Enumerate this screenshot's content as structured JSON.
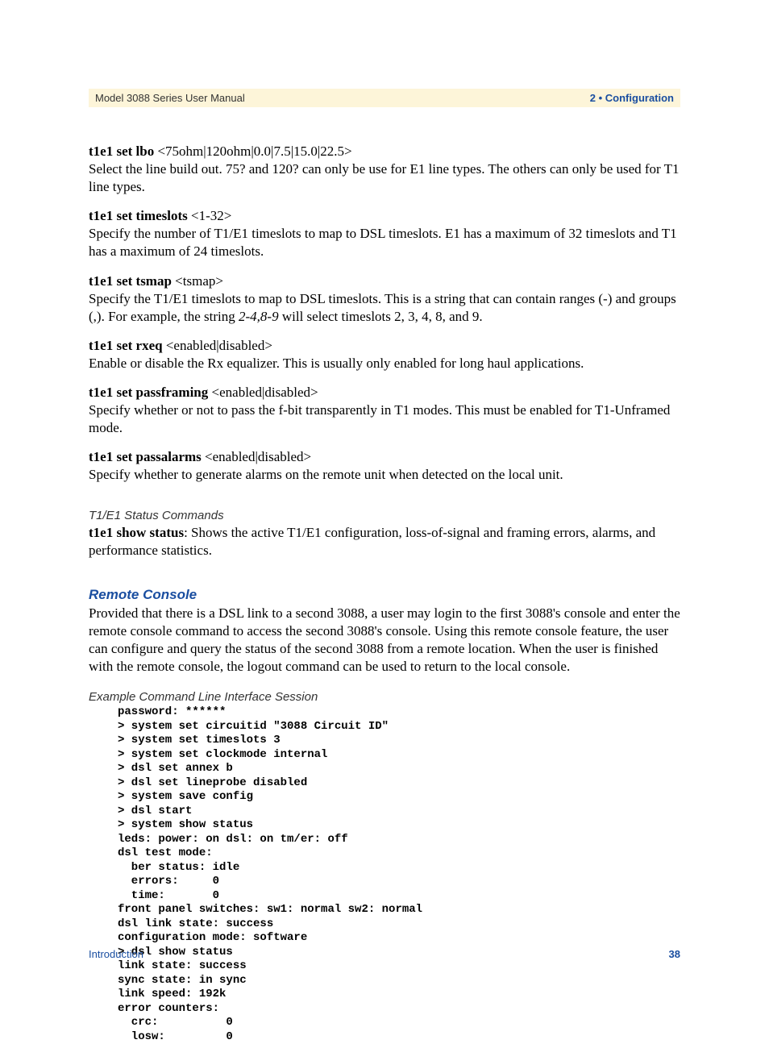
{
  "header": {
    "left": "Model 3088 Series User Manual",
    "right": "2 • Configuration"
  },
  "commands": [
    {
      "name": "t1e1 set lbo",
      "args": " <75ohm|120ohm|0.0|7.5|15.0|22.5>",
      "desc": "Select the line build out. 75? and 120? can only be use for E1 line types. The others can only be used for T1 line types."
    },
    {
      "name": "t1e1 set timeslots",
      "args": " <1-32>",
      "desc": "Specify the number of T1/E1 timeslots to map to DSL timeslots. E1 has a maximum of 32 timeslots and T1 has a maximum of 24 timeslots."
    },
    {
      "name": "t1e1 set tsmap",
      "args": " <tsmap>",
      "desc_pre": "Specify the T1/E1 timeslots to map to DSL timeslots. This is a string that can contain ranges (-) and groups (,). For example, the string ",
      "desc_em": "2-4,8-9",
      "desc_post": " will select timeslots 2, 3, 4, 8, and 9."
    },
    {
      "name": "t1e1 set rxeq",
      "args": " <enabled|disabled>",
      "desc": "Enable or disable the Rx equalizer. This is usually only enabled for long haul applications."
    },
    {
      "name": "t1e1 set passframing",
      "args": " <enabled|disabled>",
      "desc": "Specify whether or not to pass the f-bit transparently in T1 modes. This must be enabled for T1-Unframed mode."
    },
    {
      "name": "t1e1 set passalarms",
      "args": " <enabled|disabled>",
      "desc": "Specify whether to generate alarms on the remote unit when detected on the local unit."
    }
  ],
  "status_heading": "T1/E1 Status Commands",
  "status_cmd": "t1e1 show status",
  "status_desc": ": Shows the active T1/E1 configuration, loss-of-signal and framing errors, alarms, and performance statistics.",
  "remote_heading": "Remote Console",
  "remote_para": "Provided that there is a DSL link to a second 3088, a user may login to the first 3088's console and enter the remote console command to access the second 3088's console. Using this remote console feature, the user can configure and query the status of the second 3088 from a remote location. When the user is finished with the remote console, the logout command can be used to return to the local console.",
  "example_heading": "Example Command Line Interface Session",
  "code": "password: ******\n> system set circuitid \"3088 Circuit ID\"\n> system set timeslots 3\n> system set clockmode internal\n> dsl set annex b\n> dsl set lineprobe disabled\n> system save config\n> dsl start\n> system show status\nleds: power: on dsl: on tm/er: off\ndsl test mode:\n  ber status: idle\n  errors:     0\n  time:       0\nfront panel switches: sw1: normal sw2: normal\ndsl link state: success\nconfiguration mode: software\n> dsl show status\nlink state: success\nsync state: in sync\nlink speed: 192k\nerror counters:\n  crc:          0\n  losw:         0",
  "footer": {
    "left": "Introduction",
    "right": "38"
  }
}
